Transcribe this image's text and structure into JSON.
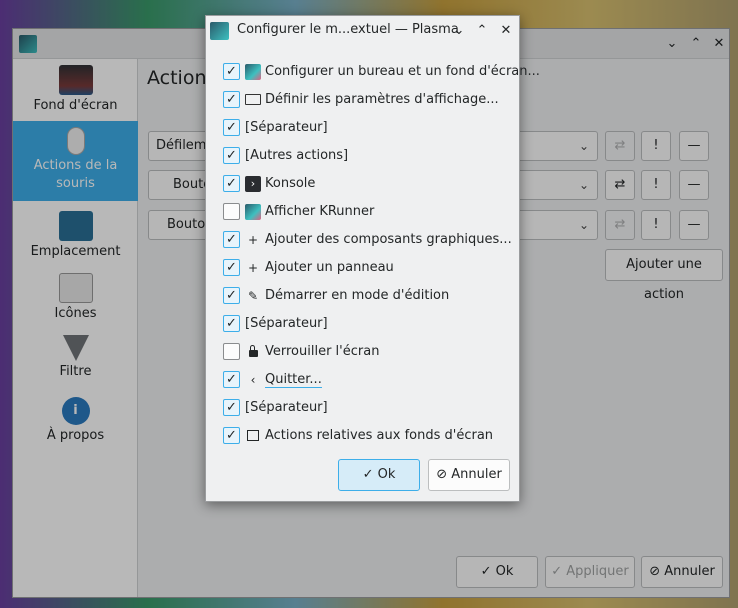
{
  "main_window": {
    "title_controls": {
      "minimize": "⌄",
      "maximize": "⌃",
      "close": "✕"
    },
    "sidebar": {
      "items": [
        {
          "label": "Fond d'écran",
          "icon": "monitor-icon"
        },
        {
          "label": "Actions de la souris",
          "icon": "mouse-icon",
          "active": true
        },
        {
          "label": "Emplacement",
          "icon": "folder-icon"
        },
        {
          "label": "Icônes",
          "icon": "icons-grid-icon"
        },
        {
          "label": "Filtre",
          "icon": "funnel-icon"
        },
        {
          "label": "À propos",
          "icon": "info-icon"
        }
      ]
    },
    "content": {
      "title": "Actions",
      "rows": [
        {
          "combo": "Défileme"
        },
        {
          "combo": "Bouto"
        },
        {
          "combo": "Bouto"
        }
      ],
      "add_action_label": "Ajouter une action",
      "footer": {
        "ok": "Ok",
        "apply": "Appliquer",
        "cancel": "Annuler"
      }
    }
  },
  "dialog": {
    "title": "Configurer le m...extuel — Plasma",
    "controls": {
      "minimize": "⌄",
      "maximize": "⌃",
      "close": "✕"
    },
    "items": [
      {
        "label": "Configurer un bureau et un fond d'écran...",
        "checked": true,
        "icon": "desktop-wallpaper-icon"
      },
      {
        "label": "Définir les paramètres d'affichage...",
        "checked": true,
        "icon": "display-icon"
      },
      {
        "label": "[Séparateur]",
        "checked": true,
        "icon": ""
      },
      {
        "label": "[Autres actions]",
        "checked": true,
        "icon": ""
      },
      {
        "label": "Konsole",
        "checked": true,
        "icon": "konsole-icon"
      },
      {
        "label": "Afficher KRunner",
        "checked": false,
        "icon": "krunner-icon"
      },
      {
        "label": "Ajouter des composants graphiques...",
        "checked": true,
        "icon": "plus-icon"
      },
      {
        "label": "Ajouter un panneau",
        "checked": true,
        "icon": "plus-icon"
      },
      {
        "label": "Démarrer en mode d'édition",
        "checked": true,
        "icon": "pencil-icon"
      },
      {
        "label": "[Séparateur]",
        "checked": true,
        "icon": ""
      },
      {
        "label": "Verrouiller l'écran",
        "checked": false,
        "icon": "lock-icon"
      },
      {
        "label": "Quitter...",
        "checked": true,
        "icon": "chevron-left-icon"
      },
      {
        "label": "[Séparateur]",
        "checked": true,
        "icon": ""
      },
      {
        "label": "Actions relatives aux fonds d'écran",
        "checked": true,
        "icon": "wallpaper-icon"
      }
    ],
    "ok_label": "Ok",
    "cancel_label": "Annuler"
  }
}
